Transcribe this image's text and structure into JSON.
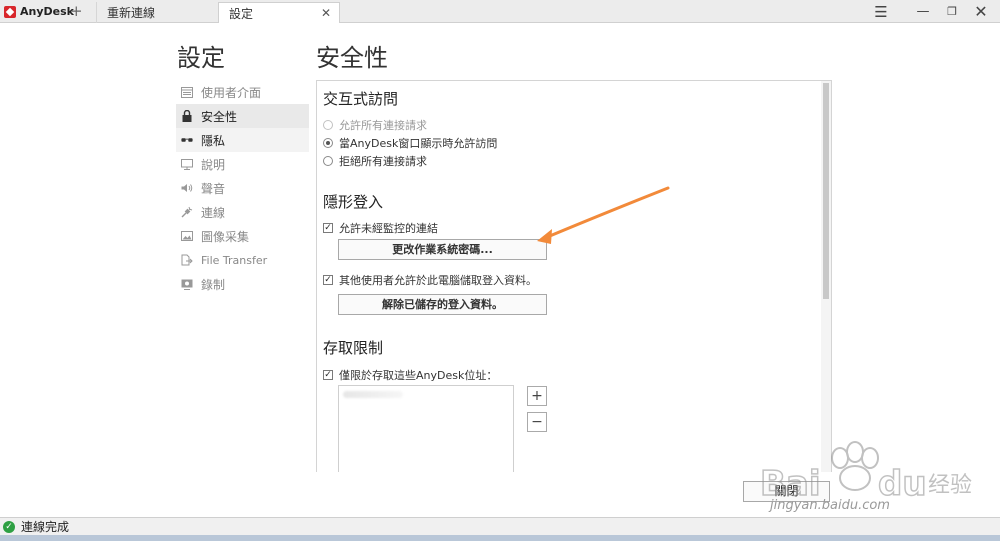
{
  "app": {
    "name": "AnyDesk"
  },
  "tabs": [
    {
      "label": "重新連線"
    },
    {
      "label": "設定"
    }
  ],
  "titlebar_icons": {
    "new_tab": "plus-icon",
    "menu": "hamburger-menu-icon",
    "minimize": "minimize-icon",
    "maximize": "maximize-icon",
    "close": "close-icon"
  },
  "page_title": "設定",
  "section_title": "安全性",
  "sidebar": {
    "items": [
      {
        "label": "使用者介面",
        "icon": "monitor-window-icon"
      },
      {
        "label": "安全性",
        "icon": "lock-icon"
      },
      {
        "label": "隱私",
        "icon": "glasses-icon"
      },
      {
        "label": "說明",
        "icon": "display-icon"
      },
      {
        "label": "聲音",
        "icon": "speaker-icon"
      },
      {
        "label": "連線",
        "icon": "plug-icon"
      },
      {
        "label": "圖像采集",
        "icon": "image-icon"
      },
      {
        "label": "File Transfer",
        "icon": "file-transfer-icon"
      },
      {
        "label": "錄制",
        "icon": "record-icon"
      }
    ]
  },
  "interactive_access": {
    "title": "交互式訪問",
    "options": [
      {
        "label": "允許所有連接請求"
      },
      {
        "label": "當AnyDesk窗口顯示時允許訪問"
      },
      {
        "label": "拒絕所有連接請求"
      }
    ]
  },
  "unattended": {
    "title": "隱形登入",
    "allow_label": "允許未經監控的連結",
    "change_password_button": "更改作業系統密碼...",
    "store_label": "其他使用者允許於此電腦儲取登入資料。",
    "clear_button": "解除已儲存的登入資料。"
  },
  "access_limit": {
    "title": "存取限制",
    "restrict_label": "僅限於存取這些AnyDesk位址：",
    "add_button": "+",
    "remove_button": "−"
  },
  "close_button": "關閉",
  "status": {
    "text": "連線完成"
  },
  "watermark": {
    "text": "jingyan.baidu.com",
    "logo_text": "Baidu 经验"
  },
  "colors": {
    "brand": "#d8262b",
    "annotation_arrow": "#f28a3a",
    "status_ok": "#2ea043"
  }
}
